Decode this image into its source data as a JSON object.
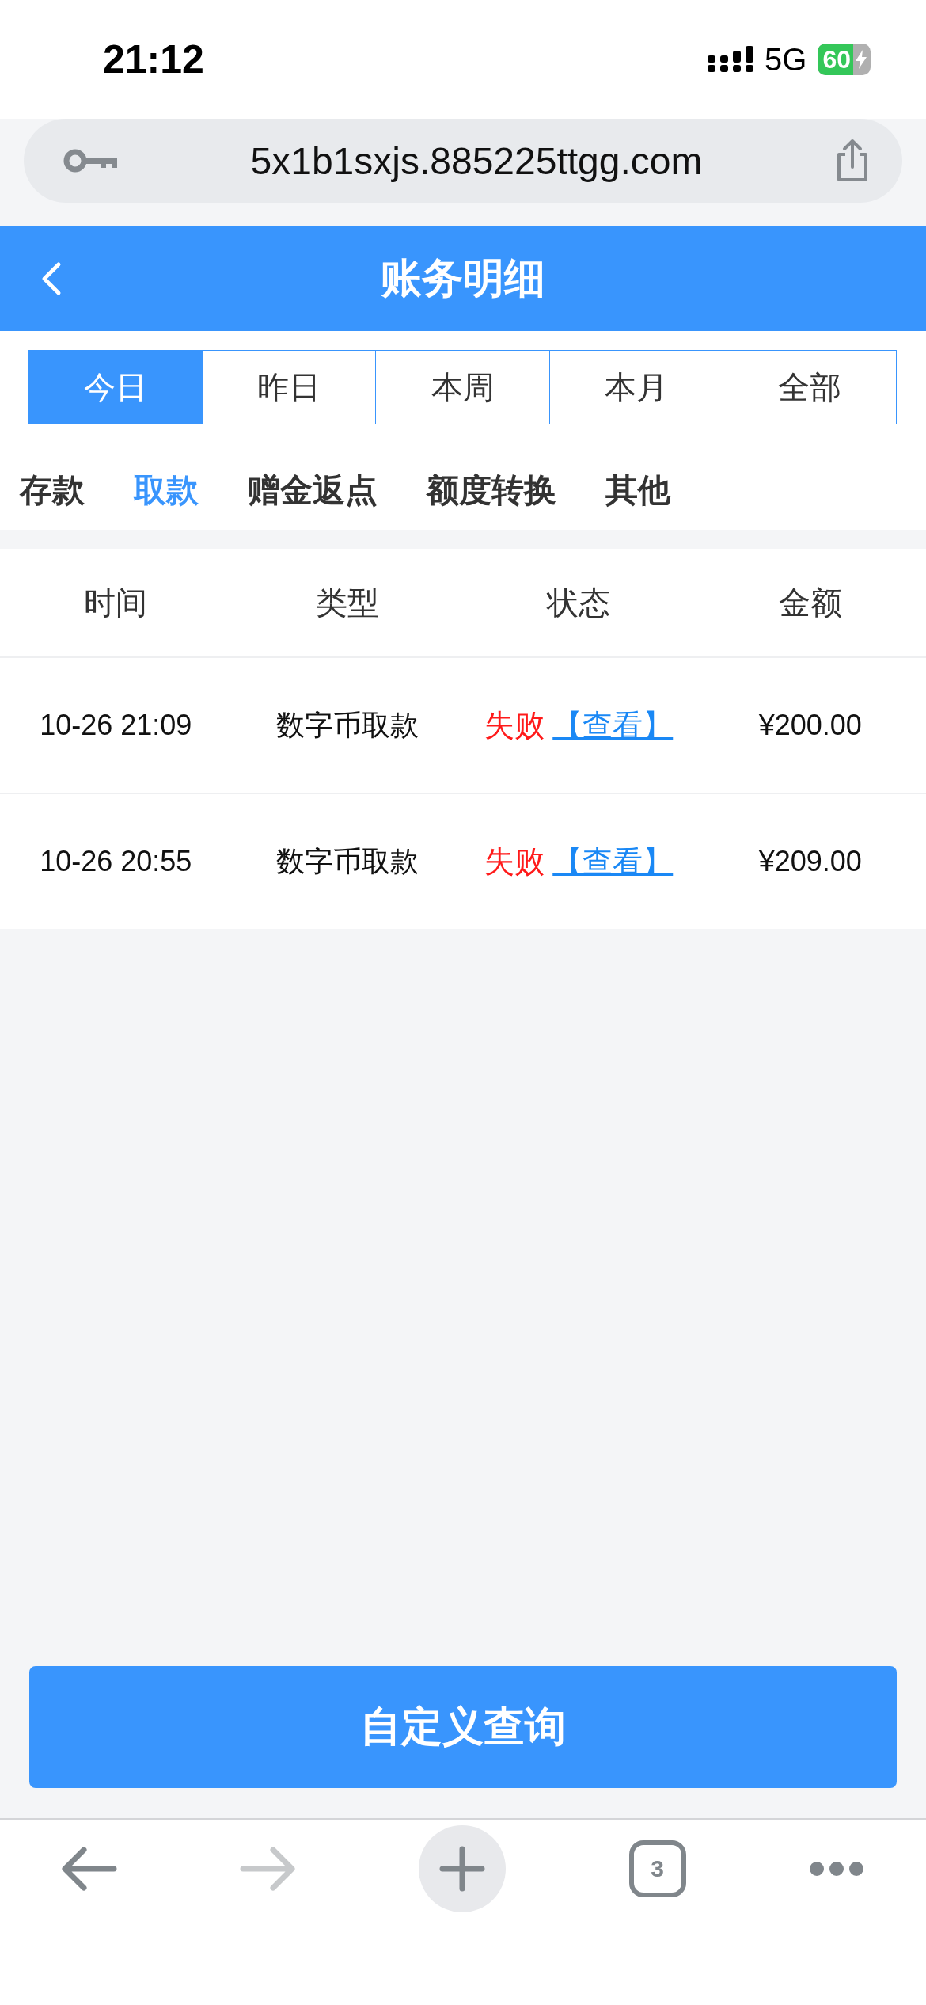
{
  "status_bar": {
    "time": "21:12",
    "network": "5G",
    "battery": "60",
    "charging": true
  },
  "address_bar": {
    "url": "5x1b1sxjs.885225ttgg.com"
  },
  "header": {
    "title": "账务明细"
  },
  "date_tabs": [
    {
      "label": "今日",
      "selected": true
    },
    {
      "label": "昨日",
      "selected": false
    },
    {
      "label": "本周",
      "selected": false
    },
    {
      "label": "本月",
      "selected": false
    },
    {
      "label": "全部",
      "selected": false
    }
  ],
  "category_tabs": [
    {
      "label": "存款",
      "selected": false
    },
    {
      "label": "取款",
      "selected": true
    },
    {
      "label": "赠金返点",
      "selected": false
    },
    {
      "label": "额度转换",
      "selected": false
    },
    {
      "label": "其他",
      "selected": false
    }
  ],
  "table": {
    "columns": [
      "时间",
      "类型",
      "状态",
      "金额"
    ],
    "rows": [
      {
        "time": "10-26 21:09",
        "type": "数字币取款",
        "status": "失败",
        "color": "#ff1a1a",
        "link": "【查看】",
        "amount": "¥200.00"
      },
      {
        "time": "10-26 20:55",
        "type": "数字币取款",
        "status": "失败",
        "color": "#ff1a1a",
        "link": "【查看】",
        "amount": "¥209.00"
      }
    ]
  },
  "query_button": "自定义查询",
  "toolbar": [
    {
      "kind": "back",
      "disabled": false
    },
    {
      "kind": "forward",
      "disabled": true
    },
    {
      "kind": "new-tab",
      "disabled": false
    },
    {
      "kind": "tabs",
      "label": "3",
      "disabled": false
    },
    {
      "kind": "more",
      "disabled": false
    }
  ]
}
